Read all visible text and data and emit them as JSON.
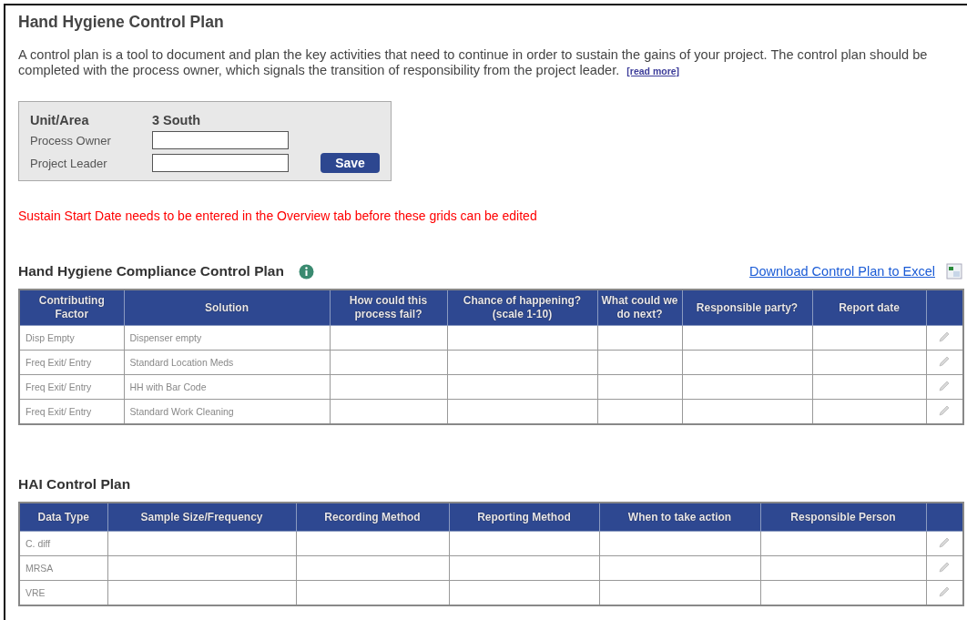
{
  "title": "Hand Hygiene Control Plan",
  "intro": "A control plan is a tool to document and plan the key activities that need to continue in order to sustain the gains of your project. The control plan should be completed with the process owner, which signals the transition of responsibility from the project leader.",
  "read_more": "[read more]",
  "form": {
    "unit_label": "Unit/Area",
    "unit_value": "3 South",
    "fields": [
      {
        "label": "Process Owner"
      },
      {
        "label": "Project Leader"
      }
    ],
    "save": "Save"
  },
  "warning": "Sustain Start Date needs to be entered in the Overview tab before these grids can be edited",
  "tables": [
    {
      "title": "Hand Hygiene Compliance Control Plan",
      "info": true,
      "download": "Download Control Plan to Excel",
      "columns": [
        "Contributing Factor",
        "Solution",
        "How could this process fail?",
        "Chance of happening? (scale 1-10)",
        "What could we do next?",
        "Responsible party?",
        "Report date"
      ],
      "rows": [
        {
          "cells": [
            "Disp Empty",
            "Dispenser empty"
          ]
        },
        {
          "cells": [
            "Freq Exit/ Entry",
            "Standard Location Meds"
          ]
        },
        {
          "cells": [
            "Freq Exit/ Entry",
            "HH with Bar Code"
          ]
        },
        {
          "cells": [
            "Freq Exit/ Entry",
            "Standard Work Cleaning"
          ]
        }
      ]
    },
    {
      "title": "HAI Control Plan",
      "columns": [
        "Data Type",
        "Sample Size/Frequency",
        "Recording Method",
        "Reporting Method",
        "When to take action",
        "Responsible Person"
      ],
      "rows": [
        {
          "cells": [
            "C. diff"
          ]
        },
        {
          "cells": [
            "MRSA"
          ]
        },
        {
          "cells": [
            "VRE"
          ]
        }
      ]
    }
  ]
}
